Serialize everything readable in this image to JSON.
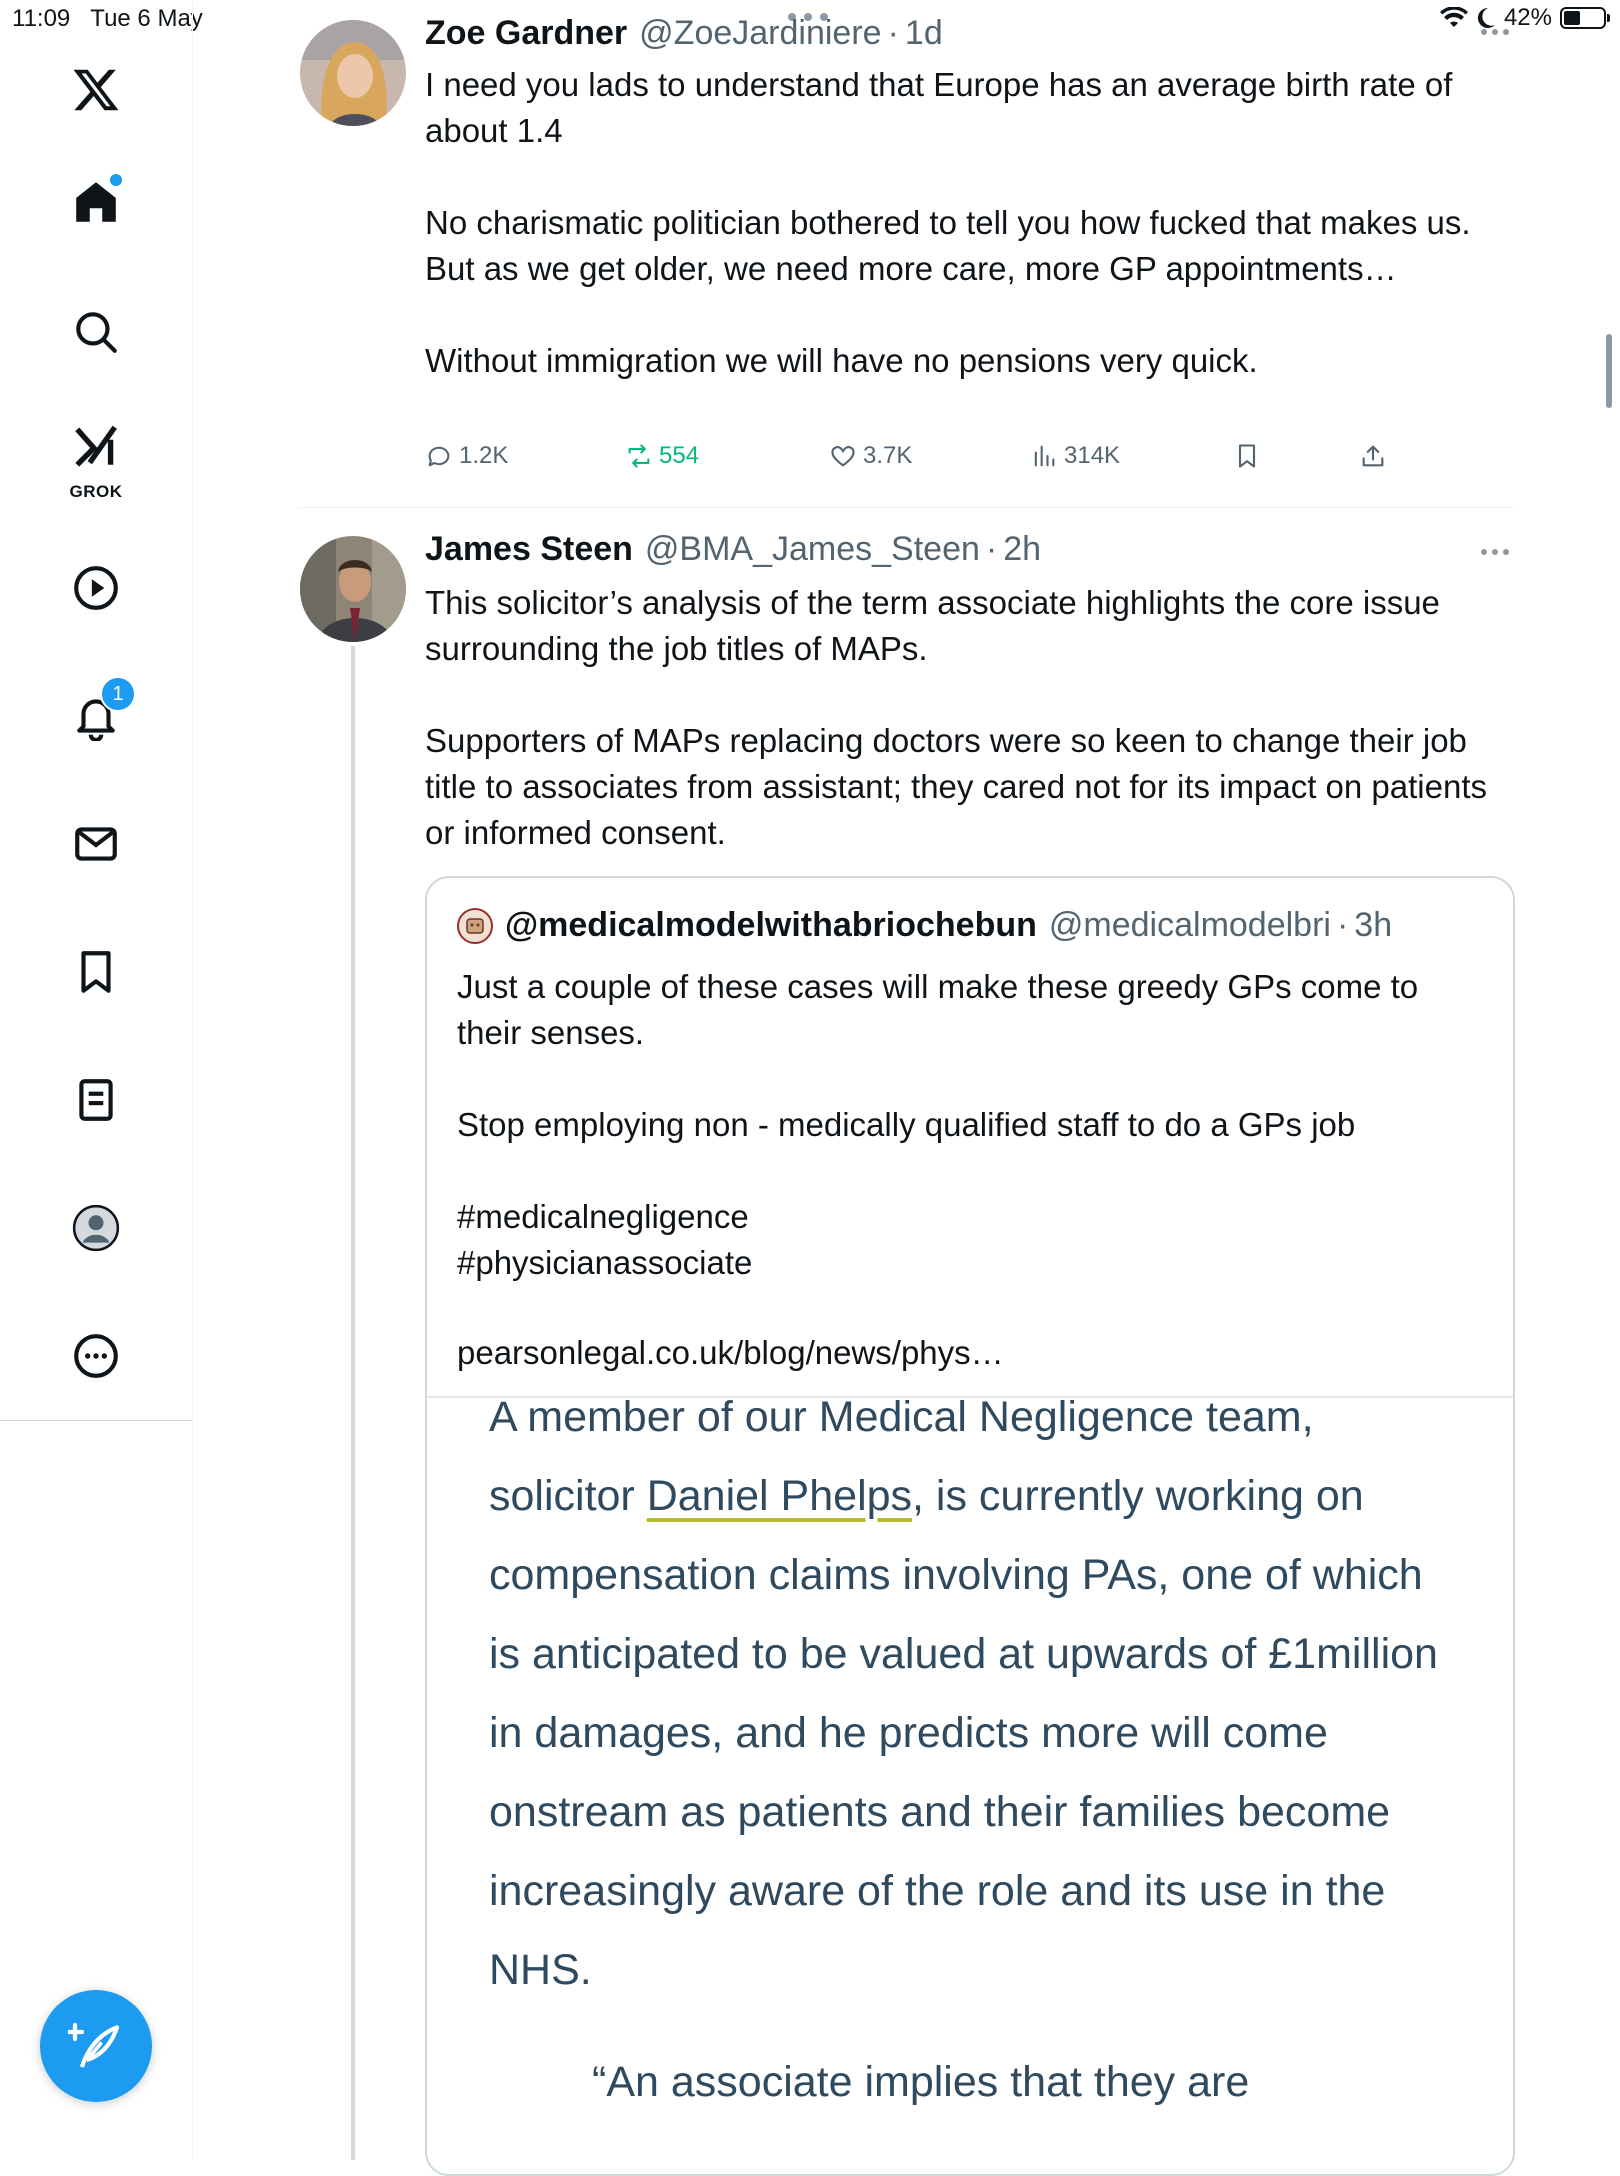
{
  "status_bar": {
    "time": "11:09",
    "date": "Tue 6 May",
    "battery": "42%",
    "battery_level": 0.42
  },
  "sidebar": {
    "grok_label": "GROK",
    "notification_count": "1"
  },
  "tweets": [
    {
      "author": "Zoe Gardner",
      "handle": "@ZoeJardiniere",
      "dot": "·",
      "time": "1d",
      "text": "I need you lads to understand that Europe has an average birth rate of about 1.4\n\nNo charismatic politician bothered to tell you how fucked that makes us.\nBut as we get older, we need more care, more GP appointments…\n\nWithout immigration we will have no pensions very quick.",
      "replies": "1.2K",
      "reposts": "554",
      "likes": "3.7K",
      "views": "314K"
    },
    {
      "author": "James Steen",
      "handle": "@BMA_James_Steen",
      "dot": "·",
      "time": "2h",
      "text": "This solicitor’s analysis of the term associate highlights the core issue surrounding the job titles of MAPs.\n\nSupporters of MAPs replacing doctors were so keen to change their job title to associates from assistant; they cared not for its impact on patients or informed consent.",
      "quote": {
        "author": "@medicalmodelwithabriochebun",
        "handle": "@medicalmodelbri",
        "dot": "·",
        "time": "3h",
        "text": "Just a couple of these cases will make these greedy GPs come to their senses.\n\nStop employing non - medically qualified staff to do a GPs job\n\n#medicalnegligence\n#physicianassociate",
        "link": "pearsonlegal.co.uk/blog/news/phys…",
        "image": {
          "line1": "A member of our Medical Negligence team,",
          "line2_a": "solicitor ",
          "line2_link": "Daniel Phelps",
          "line2_b": ", is currently working on",
          "line3": "compensation claims involving PAs, one of which",
          "line4": "is anticipated to be valued at upwards of £1million",
          "line5": "in damages, and he predicts more will come",
          "line6": "onstream as patients and their families become",
          "line7": "increasingly aware of the role and its use in the",
          "line8": "NHS.",
          "quote_start": "“An associate implies that they are"
        }
      }
    }
  ]
}
